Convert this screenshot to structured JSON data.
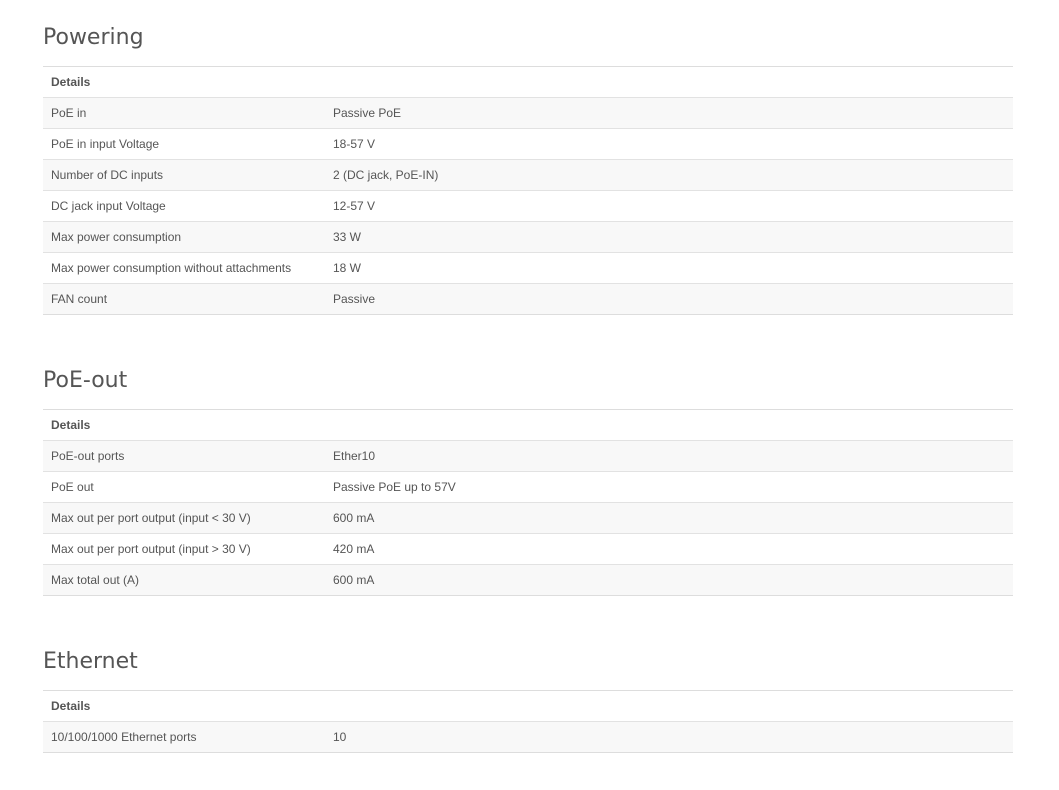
{
  "sections": [
    {
      "title": "Powering",
      "header": "Details",
      "rows": [
        {
          "label": "PoE in",
          "value": "Passive PoE"
        },
        {
          "label": "PoE in input Voltage",
          "value": "18-57 V"
        },
        {
          "label": "Number of DC inputs",
          "value": "2 (DC jack, PoE-IN)"
        },
        {
          "label": "DC jack input Voltage",
          "value": "12-57 V"
        },
        {
          "label": "Max power consumption",
          "value": "33 W"
        },
        {
          "label": "Max power consumption without attachments",
          "value": "18 W"
        },
        {
          "label": "FAN count",
          "value": "Passive"
        }
      ]
    },
    {
      "title": "PoE-out",
      "header": "Details",
      "rows": [
        {
          "label": "PoE-out ports",
          "value": "Ether10"
        },
        {
          "label": "PoE out",
          "value": "Passive PoE up to 57V"
        },
        {
          "label": "Max out per port output (input < 30 V)",
          "value": "600 mA"
        },
        {
          "label": "Max out per port output (input > 30 V)",
          "value": "420 mA"
        },
        {
          "label": "Max total out (A)",
          "value": "600 mA"
        }
      ]
    },
    {
      "title": "Ethernet",
      "header": "Details",
      "rows": [
        {
          "label": "10/100/1000 Ethernet ports",
          "value": "10"
        }
      ]
    }
  ]
}
